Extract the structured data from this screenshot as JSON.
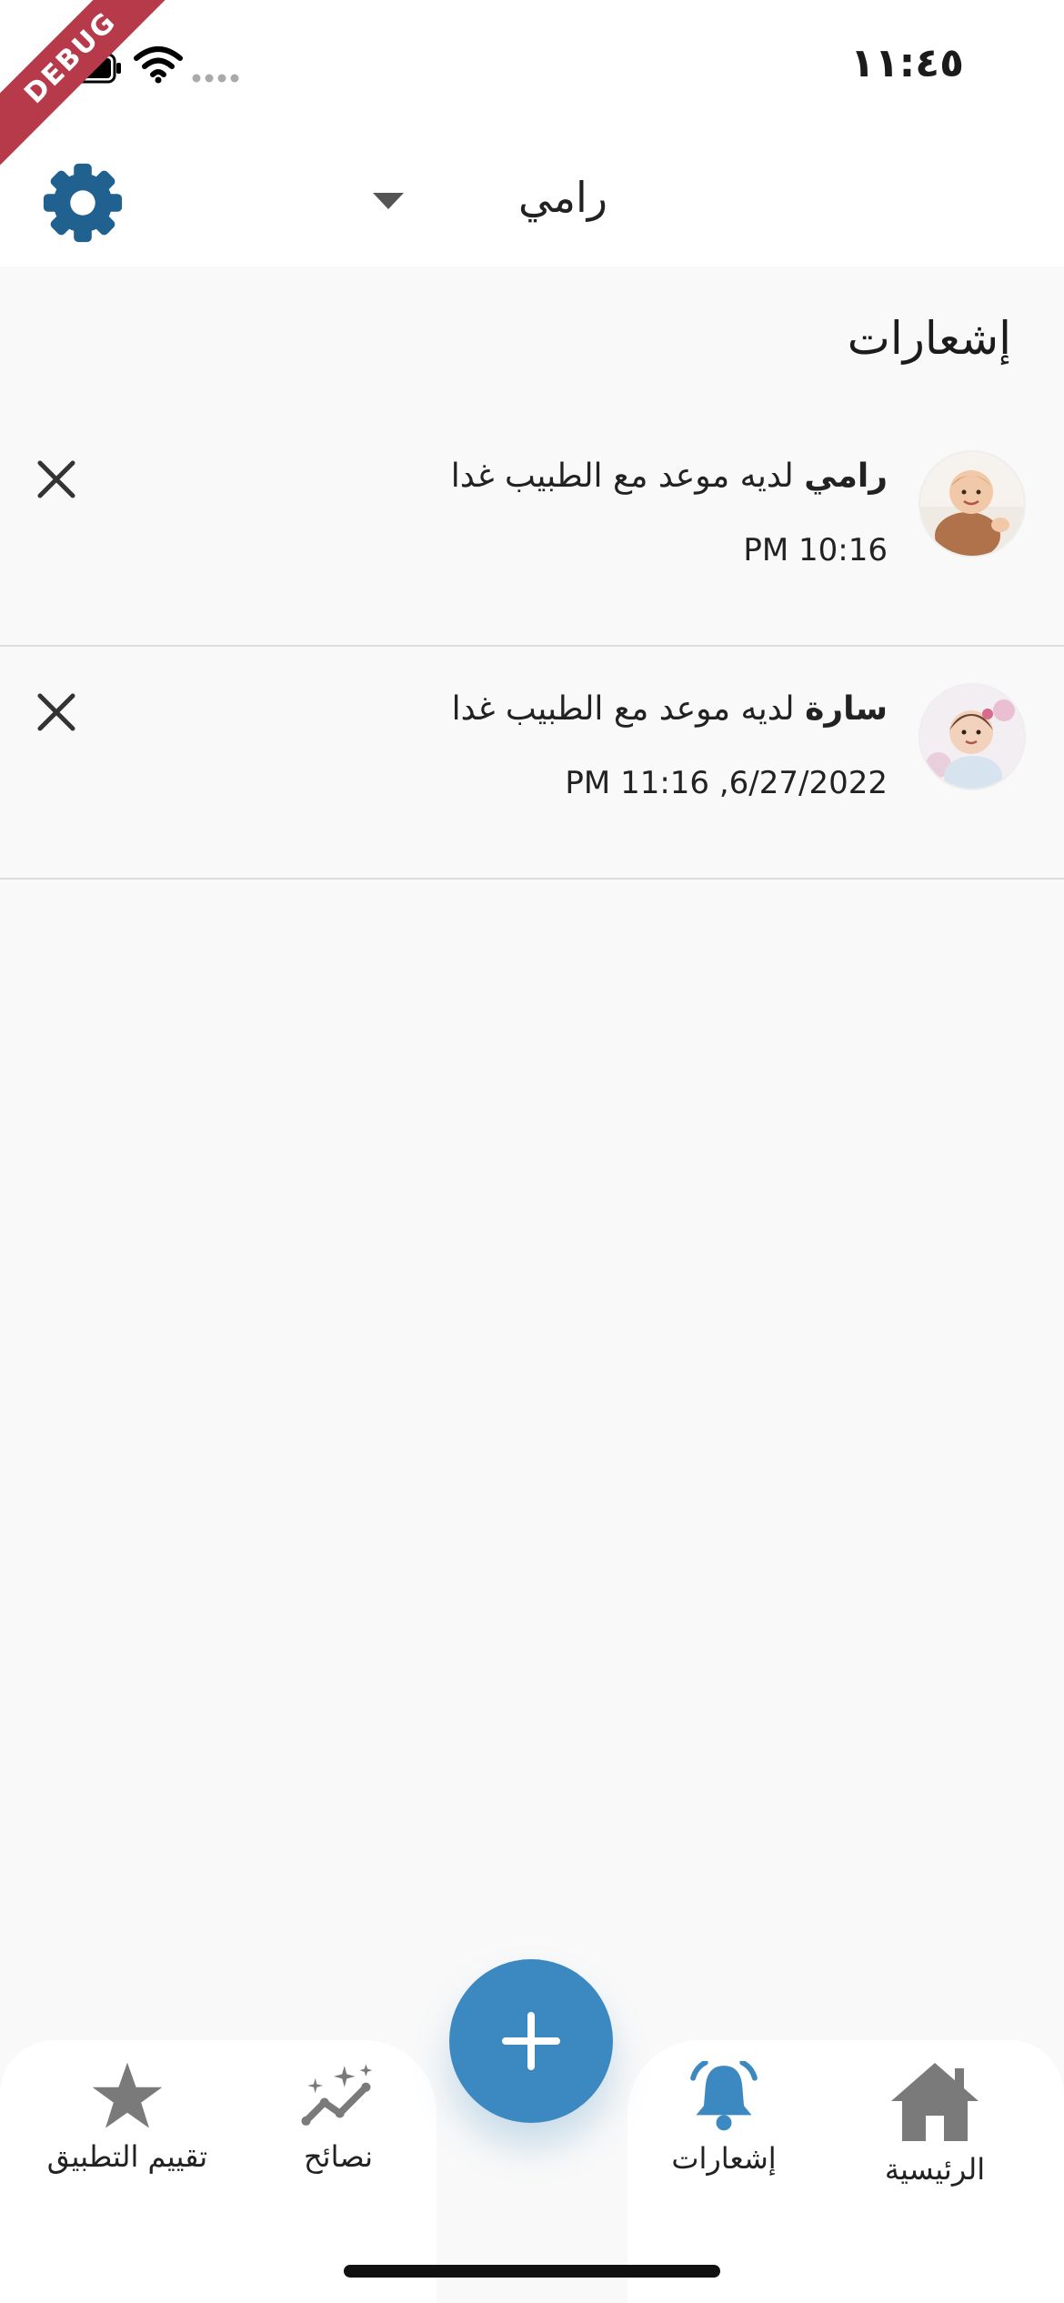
{
  "status_bar": {
    "time": "١١:٤٥",
    "debug_label": "DEBUG"
  },
  "app_bar": {
    "selected_child": "رامي"
  },
  "page": {
    "title": "إشعارات"
  },
  "notifications": [
    {
      "child_name": "رامي",
      "message": "لديه موعد مع الطبيب غدا",
      "time": "PM 10:16"
    },
    {
      "child_name": "سارة",
      "message": "لديه موعد مع الطبيب غدا",
      "time": "PM 11:16 ,6/27/2022"
    }
  ],
  "bottom_nav": {
    "home_label": "الرئيسية",
    "notifications_label": "إشعارات",
    "tips_label": "نصائح",
    "rate_label": "تقييم التطبيق",
    "active_item": "notifications"
  },
  "colors": {
    "accent": "#3b89c0",
    "settings_icon": "#20618f",
    "inactive_icon": "#7a7a7a",
    "debug_banner": "#b73a4b"
  }
}
